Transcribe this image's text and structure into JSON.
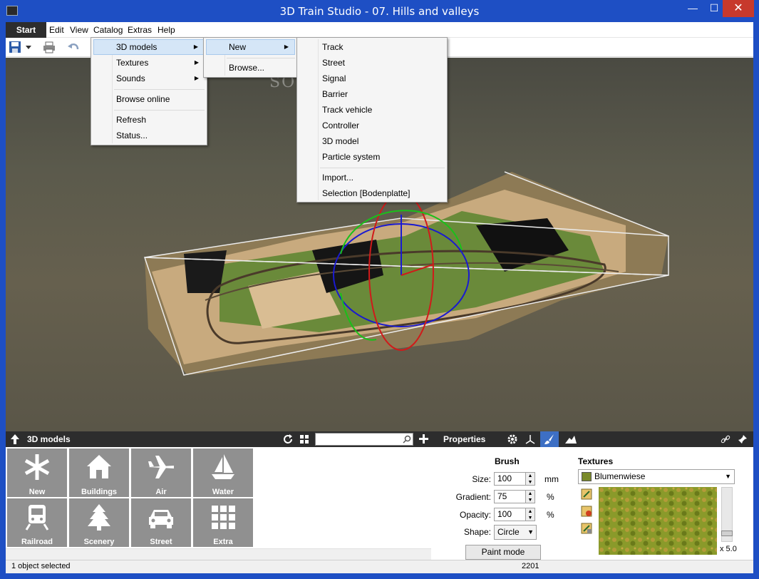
{
  "window": {
    "title": "3D Train Studio - 07. Hills and valleys",
    "minimize": "—",
    "maximize": "☐",
    "close": "✕"
  },
  "menubar": {
    "start": "Start",
    "items": [
      "Edit",
      "View",
      "Catalog",
      "Extras",
      "Help"
    ]
  },
  "watermark": "SOFTPEDIA",
  "catalog_menu": {
    "items": [
      "3D models",
      "Textures",
      "Sounds",
      "Browse online",
      "Refresh",
      "Status..."
    ]
  },
  "models_submenu": {
    "items": [
      "New",
      "Browse..."
    ]
  },
  "new_submenu": {
    "items": [
      "Track",
      "Street",
      "Signal",
      "Barrier",
      "Track vehicle",
      "Controller",
      "3D model",
      "Particle system",
      "Import...",
      "Selection [Bodenplatte]"
    ]
  },
  "left_panel": {
    "title": "3D models",
    "search_value": "",
    "tiles": [
      {
        "label": "New",
        "icon": "asterisk-icon"
      },
      {
        "label": "Buildings",
        "icon": "house-icon"
      },
      {
        "label": "Air",
        "icon": "airplane-icon"
      },
      {
        "label": "Water",
        "icon": "sailboat-icon"
      },
      {
        "label": "Railroad",
        "icon": "train-icon"
      },
      {
        "label": "Scenery",
        "icon": "tree-icon"
      },
      {
        "label": "Street",
        "icon": "car-icon"
      },
      {
        "label": "Extra",
        "icon": "grid-icon"
      }
    ]
  },
  "properties": {
    "title": "Properties",
    "brush": {
      "heading": "Brush",
      "size_label": "Size:",
      "size_value": "100",
      "size_unit": "mm",
      "gradient_label": "Gradient:",
      "gradient_value": "75",
      "gradient_unit": "%",
      "opacity_label": "Opacity:",
      "opacity_value": "100",
      "opacity_unit": "%",
      "shape_label": "Shape:",
      "shape_value": "Circle",
      "paint_mode": "Paint mode"
    },
    "textures": {
      "heading": "Textures",
      "selected": "Blumenwiese",
      "zoom": "x 5.0",
      "slider_level": 0.1
    }
  },
  "statusbar": {
    "left": "1 object selected",
    "center": "2201"
  },
  "colors": {
    "title_bar": "#1e4fc4",
    "dark_header": "#2d2d2d",
    "tile": "#909090",
    "menu_highlight": "#d5e6f7"
  }
}
